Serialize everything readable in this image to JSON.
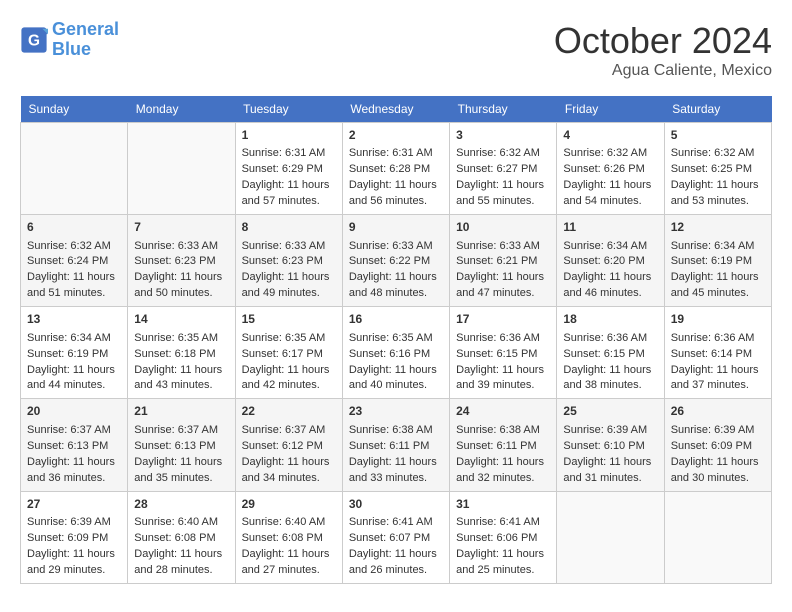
{
  "logo": {
    "line1": "General",
    "line2": "Blue"
  },
  "title": "October 2024",
  "location": "Agua Caliente, Mexico",
  "weekdays": [
    "Sunday",
    "Monday",
    "Tuesday",
    "Wednesday",
    "Thursday",
    "Friday",
    "Saturday"
  ],
  "weeks": [
    [
      {
        "day": "",
        "lines": []
      },
      {
        "day": "",
        "lines": []
      },
      {
        "day": "1",
        "lines": [
          "Sunrise: 6:31 AM",
          "Sunset: 6:29 PM",
          "Daylight: 11 hours and 57 minutes."
        ]
      },
      {
        "day": "2",
        "lines": [
          "Sunrise: 6:31 AM",
          "Sunset: 6:28 PM",
          "Daylight: 11 hours and 56 minutes."
        ]
      },
      {
        "day": "3",
        "lines": [
          "Sunrise: 6:32 AM",
          "Sunset: 6:27 PM",
          "Daylight: 11 hours and 55 minutes."
        ]
      },
      {
        "day": "4",
        "lines": [
          "Sunrise: 6:32 AM",
          "Sunset: 6:26 PM",
          "Daylight: 11 hours and 54 minutes."
        ]
      },
      {
        "day": "5",
        "lines": [
          "Sunrise: 6:32 AM",
          "Sunset: 6:25 PM",
          "Daylight: 11 hours and 53 minutes."
        ]
      }
    ],
    [
      {
        "day": "6",
        "lines": [
          "Sunrise: 6:32 AM",
          "Sunset: 6:24 PM",
          "Daylight: 11 hours and 51 minutes."
        ]
      },
      {
        "day": "7",
        "lines": [
          "Sunrise: 6:33 AM",
          "Sunset: 6:23 PM",
          "Daylight: 11 hours and 50 minutes."
        ]
      },
      {
        "day": "8",
        "lines": [
          "Sunrise: 6:33 AM",
          "Sunset: 6:23 PM",
          "Daylight: 11 hours and 49 minutes."
        ]
      },
      {
        "day": "9",
        "lines": [
          "Sunrise: 6:33 AM",
          "Sunset: 6:22 PM",
          "Daylight: 11 hours and 48 minutes."
        ]
      },
      {
        "day": "10",
        "lines": [
          "Sunrise: 6:33 AM",
          "Sunset: 6:21 PM",
          "Daylight: 11 hours and 47 minutes."
        ]
      },
      {
        "day": "11",
        "lines": [
          "Sunrise: 6:34 AM",
          "Sunset: 6:20 PM",
          "Daylight: 11 hours and 46 minutes."
        ]
      },
      {
        "day": "12",
        "lines": [
          "Sunrise: 6:34 AM",
          "Sunset: 6:19 PM",
          "Daylight: 11 hours and 45 minutes."
        ]
      }
    ],
    [
      {
        "day": "13",
        "lines": [
          "Sunrise: 6:34 AM",
          "Sunset: 6:19 PM",
          "Daylight: 11 hours and 44 minutes."
        ]
      },
      {
        "day": "14",
        "lines": [
          "Sunrise: 6:35 AM",
          "Sunset: 6:18 PM",
          "Daylight: 11 hours and 43 minutes."
        ]
      },
      {
        "day": "15",
        "lines": [
          "Sunrise: 6:35 AM",
          "Sunset: 6:17 PM",
          "Daylight: 11 hours and 42 minutes."
        ]
      },
      {
        "day": "16",
        "lines": [
          "Sunrise: 6:35 AM",
          "Sunset: 6:16 PM",
          "Daylight: 11 hours and 40 minutes."
        ]
      },
      {
        "day": "17",
        "lines": [
          "Sunrise: 6:36 AM",
          "Sunset: 6:15 PM",
          "Daylight: 11 hours and 39 minutes."
        ]
      },
      {
        "day": "18",
        "lines": [
          "Sunrise: 6:36 AM",
          "Sunset: 6:15 PM",
          "Daylight: 11 hours and 38 minutes."
        ]
      },
      {
        "day": "19",
        "lines": [
          "Sunrise: 6:36 AM",
          "Sunset: 6:14 PM",
          "Daylight: 11 hours and 37 minutes."
        ]
      }
    ],
    [
      {
        "day": "20",
        "lines": [
          "Sunrise: 6:37 AM",
          "Sunset: 6:13 PM",
          "Daylight: 11 hours and 36 minutes."
        ]
      },
      {
        "day": "21",
        "lines": [
          "Sunrise: 6:37 AM",
          "Sunset: 6:13 PM",
          "Daylight: 11 hours and 35 minutes."
        ]
      },
      {
        "day": "22",
        "lines": [
          "Sunrise: 6:37 AM",
          "Sunset: 6:12 PM",
          "Daylight: 11 hours and 34 minutes."
        ]
      },
      {
        "day": "23",
        "lines": [
          "Sunrise: 6:38 AM",
          "Sunset: 6:11 PM",
          "Daylight: 11 hours and 33 minutes."
        ]
      },
      {
        "day": "24",
        "lines": [
          "Sunrise: 6:38 AM",
          "Sunset: 6:11 PM",
          "Daylight: 11 hours and 32 minutes."
        ]
      },
      {
        "day": "25",
        "lines": [
          "Sunrise: 6:39 AM",
          "Sunset: 6:10 PM",
          "Daylight: 11 hours and 31 minutes."
        ]
      },
      {
        "day": "26",
        "lines": [
          "Sunrise: 6:39 AM",
          "Sunset: 6:09 PM",
          "Daylight: 11 hours and 30 minutes."
        ]
      }
    ],
    [
      {
        "day": "27",
        "lines": [
          "Sunrise: 6:39 AM",
          "Sunset: 6:09 PM",
          "Daylight: 11 hours and 29 minutes."
        ]
      },
      {
        "day": "28",
        "lines": [
          "Sunrise: 6:40 AM",
          "Sunset: 6:08 PM",
          "Daylight: 11 hours and 28 minutes."
        ]
      },
      {
        "day": "29",
        "lines": [
          "Sunrise: 6:40 AM",
          "Sunset: 6:08 PM",
          "Daylight: 11 hours and 27 minutes."
        ]
      },
      {
        "day": "30",
        "lines": [
          "Sunrise: 6:41 AM",
          "Sunset: 6:07 PM",
          "Daylight: 11 hours and 26 minutes."
        ]
      },
      {
        "day": "31",
        "lines": [
          "Sunrise: 6:41 AM",
          "Sunset: 6:06 PM",
          "Daylight: 11 hours and 25 minutes."
        ]
      },
      {
        "day": "",
        "lines": []
      },
      {
        "day": "",
        "lines": []
      }
    ]
  ]
}
